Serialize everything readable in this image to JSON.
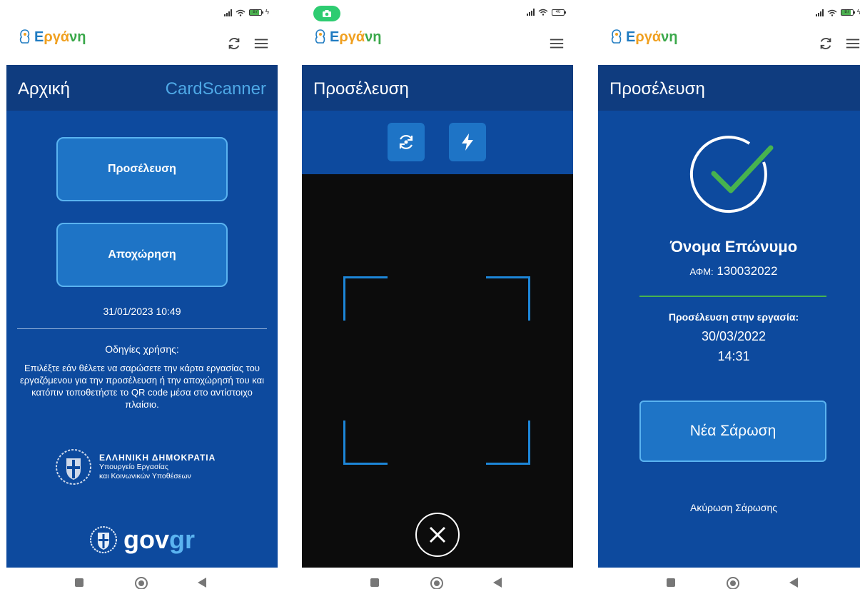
{
  "app": {
    "logo_text": [
      "Ε",
      "ργά",
      "νη"
    ]
  },
  "status": {
    "battery1": "87",
    "battery2": "40",
    "battery3": "87"
  },
  "screen1": {
    "title": "Αρχική",
    "right_title": "CardScanner",
    "button_arrival": "Προσέλευση",
    "button_departure": "Αποχώρηση",
    "datetime": "31/01/2023 10:49",
    "help_heading": "Οδηγίες χρήσης:",
    "help_text": "Επιλέξτε εάν θέλετε να σαρώσετε την κάρτα εργασίας του εργαζόμενου για την προσέλευση ή την αποχώρησή του και κατόπιν τοποθετήστε το QR code μέσα στο αντίστοιχο πλαίσιο.",
    "gov_line1": "ΕΛΛΗΝΙΚΗ ΔΗΜΟΚΡΑΤΙΑ",
    "gov_line2": "Υπουργείο Εργασίας",
    "gov_line3": "και Κοινωνικών Υποθέσεων",
    "govgr_a": "gov",
    "govgr_b": "gr"
  },
  "screen2": {
    "title": "Προσέλευση"
  },
  "screen3": {
    "title": "Προσέλευση",
    "name": "Όνομα Επώνυμο",
    "afm_label": "ΑΦΜ:",
    "afm_value": "130032022",
    "attendance_label": "Προσέλευση στην εργασία:",
    "date": "30/03/2022",
    "time": "14:31",
    "new_scan": "Νέα Σάρωση",
    "cancel_scan": "Ακύρωση Σάρωσης"
  },
  "colors": {
    "header": "#0f3c7f",
    "body": "#0d4a9e",
    "button": "#1e74c6",
    "accent": "#5ab3f0",
    "success": "#47b34f"
  },
  "icons": [
    "refresh-icon",
    "menu-icon",
    "camera-switch-icon",
    "flash-icon",
    "close-icon",
    "checkmark-icon",
    "coat-of-arms-icon"
  ]
}
